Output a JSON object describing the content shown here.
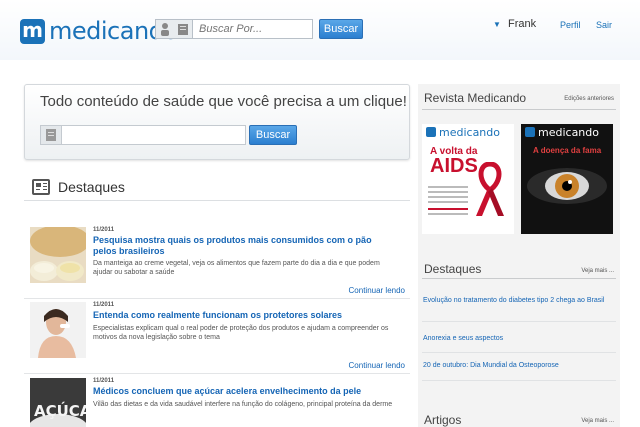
{
  "header": {
    "logo_letter": "m",
    "logo_text": "medicando",
    "search_placeholder": "Buscar Por...",
    "search_button": "Buscar",
    "user_name": "Frank",
    "nav": [
      "Perfil",
      "Sair"
    ]
  },
  "promo": {
    "title": "Todo conteúdo de saúde que você precisa a um clique!",
    "button": "Buscar"
  },
  "destaques": {
    "title": "Destaques",
    "articles": [
      {
        "date": "11/2011",
        "title": "Pesquisa mostra quais os produtos mais consumidos com o pão pelos brasileiros",
        "desc": "Da manteiga ao creme vegetal, veja os alimentos que fazem parte do dia a dia e que podem ajudar ou sabotar a saúde",
        "more": "Continuar lendo"
      },
      {
        "date": "11/2011",
        "title": "Entenda como realmente funcionam os protetores solares",
        "desc": "Especialistas explicam qual o real poder de proteção dos produtos e ajudam a compreender os motivos da nova legislação sobre o tema",
        "more": "Continuar lendo"
      },
      {
        "date": "11/2011",
        "title": "Médicos concluem que açúcar acelera envelhecimento da pele",
        "desc": "Vilão das dietas e da vida saudável interfere na função do colágeno, principal proteína da derme",
        "more": ""
      }
    ]
  },
  "sidebar": {
    "revista": {
      "title": "Revista Medicando",
      "link": "Edições anteriores",
      "mag1_logo": "medicando",
      "mag1_headline_1": "A volta da",
      "mag1_headline_2": "AIDS",
      "mag2_logo": "medicando",
      "mag2_headline": "A doença da fama"
    },
    "destaques": {
      "title": "Destaques",
      "link": "Veja mais ...",
      "items": [
        "Evolução no tratamento do diabetes tipo 2 chega ao Brasil",
        "Anorexia e seus aspectos",
        "20 de outubro: Dia Mundial da Osteoporose"
      ]
    },
    "artigos": {
      "title": "Artigos",
      "link": "Veja mais ..."
    }
  },
  "colors": {
    "brand": "#1b72b8",
    "link": "#1565b5",
    "button": "#2b7fd0"
  }
}
